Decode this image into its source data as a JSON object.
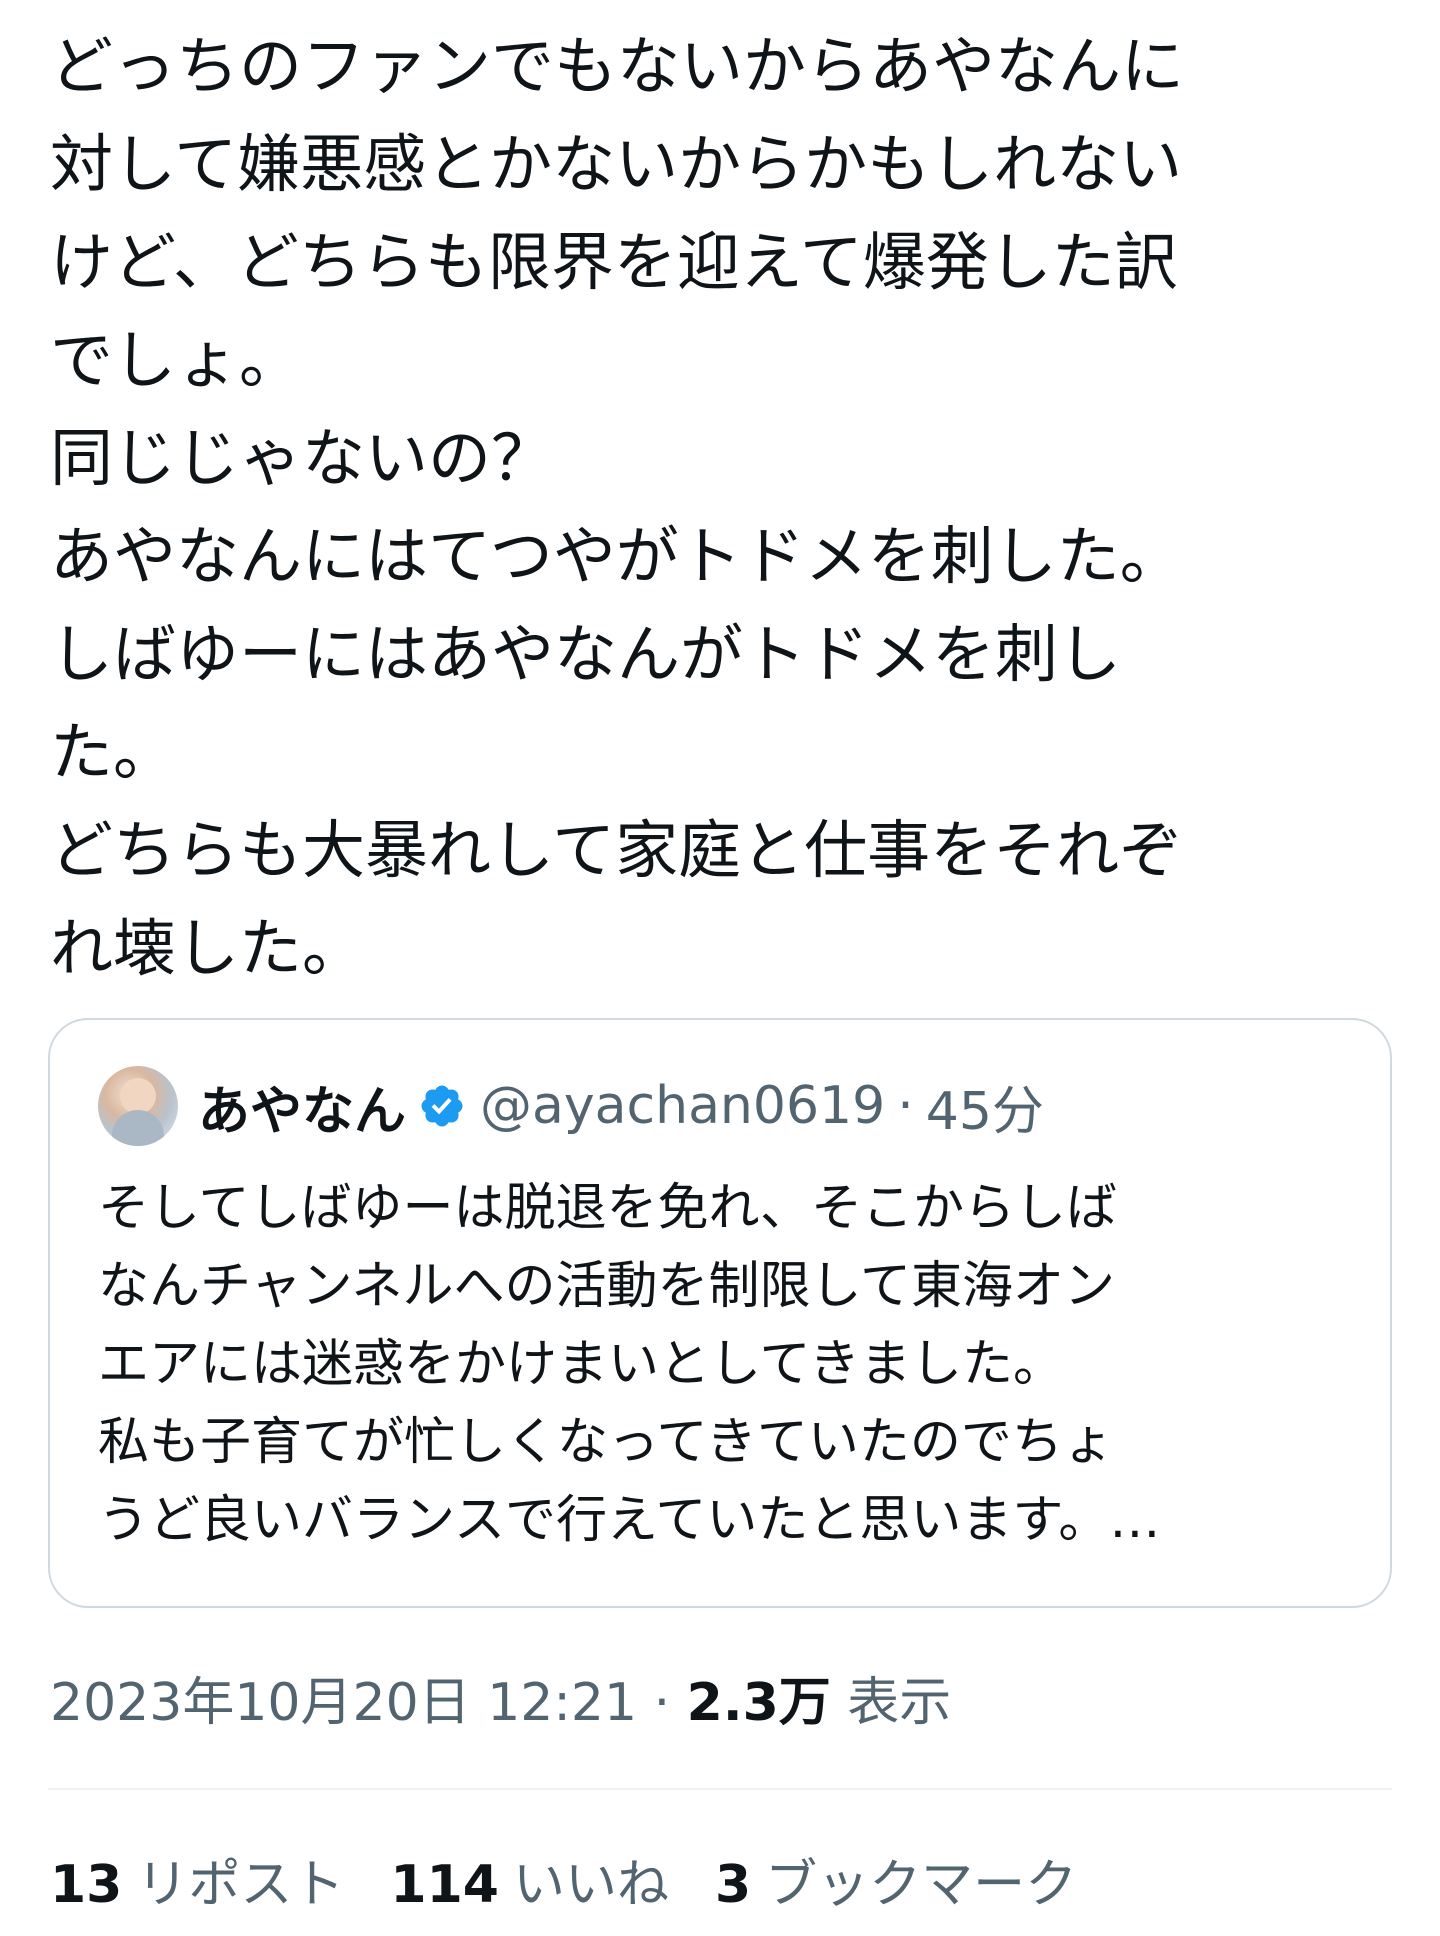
{
  "tweet": {
    "text": "どっちのファンでもないからあやなんに\n対して嫌悪感とかないからかもしれない\nけど、どちらも限界を迎えて爆発した訳\nでしょ。\n同じじゃないの？\nあやなんにはてつやがトドメを刺した。\nしばゆーにはあやなんがトドメを刺し\nた。\nどちらも大暴れして家庭と仕事をそれぞ\nれ壊した。"
  },
  "quote": {
    "name": "あやなん",
    "verified_icon": "verified-badge-icon",
    "handle": "@ayachan0619",
    "separator": "·",
    "time": "45分",
    "text": "そしてしばゆーは脱退を免れ、そこからしば\nなんチャンネルへの活動を制限して東海オン\nエアには迷惑をかけまいとしてきました。\n私も子育てが忙しくなってきていたのでちょ\nうど良いバランスで行えていたと思います。…"
  },
  "meta": {
    "datetime": "2023年10月20日 12:21",
    "separator": " · ",
    "views_count": "2.3万",
    "views_label": " 表示"
  },
  "stats": {
    "reposts_count": "13",
    "reposts_label": "リポスト",
    "likes_count": "114",
    "likes_label": "いいね",
    "bookmarks_count": "3",
    "bookmarks_label": "ブックマーク"
  },
  "colors": {
    "text": "#0f1419",
    "secondary": "#536471",
    "border": "#cfd9de",
    "verified": "#1d9bf0"
  }
}
